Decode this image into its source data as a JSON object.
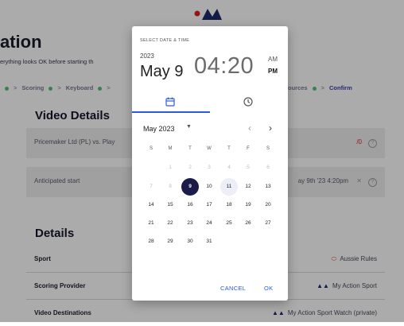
{
  "page": {
    "title": "ation",
    "subtitle": "erything looks OK before starting th",
    "steps": [
      "Scoring",
      "Keyboard"
    ],
    "steps_tail": [
      "ources",
      "Confirm"
    ]
  },
  "video_details": {
    "heading": "Video Details",
    "match": {
      "label": "Pricemaker Ltd (PL) vs. Play",
      "value": "/0"
    },
    "start": {
      "label": "Anticipated start",
      "value": "ay 9th '23 4:20pm"
    }
  },
  "details": {
    "heading": "Details",
    "rows": [
      {
        "label": "Sport",
        "value": "Aussie Rules"
      },
      {
        "label": "Scoring Provider",
        "value": "My Action Sport"
      },
      {
        "label": "Video Destinations",
        "value": "My Action Sport Watch (private)"
      }
    ]
  },
  "picker": {
    "header": "SELECT DATE & TIME",
    "year": "2023",
    "date": "May 9",
    "time": "04:20",
    "am": "AM",
    "pm": "PM",
    "selected_period": "PM",
    "tabs": [
      "calendar-icon",
      "clock-icon"
    ],
    "month_label": "May 2023",
    "weekdays": [
      "S",
      "M",
      "T",
      "W",
      "T",
      "F",
      "S"
    ],
    "weeks": [
      [
        "",
        "1",
        "2",
        "3",
        "4",
        "5",
        "6"
      ],
      [
        "7",
        "8",
        "9",
        "10",
        "11",
        "12",
        "13"
      ],
      [
        "14",
        "15",
        "16",
        "17",
        "18",
        "19",
        "20"
      ],
      [
        "21",
        "22",
        "23",
        "24",
        "25",
        "26",
        "27"
      ],
      [
        "28",
        "29",
        "30",
        "31",
        "",
        "",
        ""
      ]
    ],
    "selected_day": "9",
    "today_day": "11",
    "disabled_through": "8",
    "cancel_label": "CANCEL",
    "ok_label": "OK"
  },
  "colors": {
    "accent": "#2f5bd8",
    "selected": "#1c1a48",
    "step_dot": "#52c07a",
    "confirm": "#3b3fae"
  }
}
